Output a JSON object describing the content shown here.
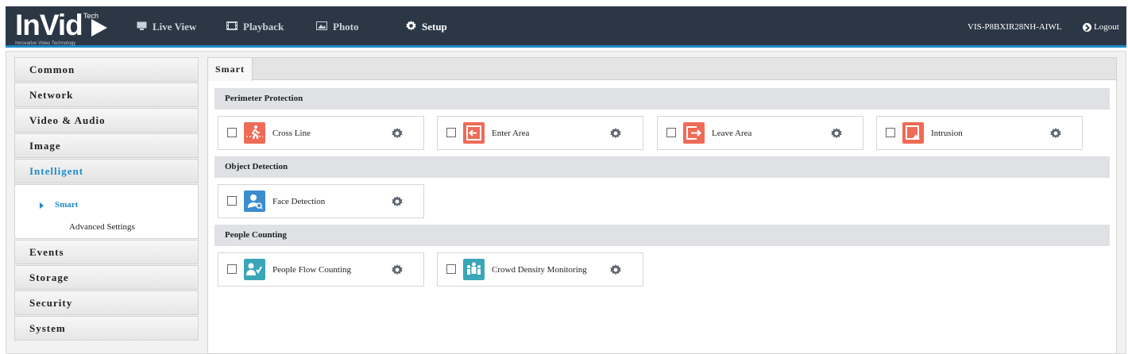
{
  "header": {
    "logo_text": "InVid",
    "logo_tech": "Tech",
    "logo_sub": "Innovative Video Technology",
    "nav": [
      {
        "label": "Live View",
        "icon": "monitor-icon"
      },
      {
        "label": "Playback",
        "icon": "film-icon"
      },
      {
        "label": "Photo",
        "icon": "photo-icon"
      },
      {
        "label": "Setup",
        "icon": "gear-icon",
        "active": true
      }
    ],
    "device_name": "VIS-P8BXIR28NH-AIWL",
    "logout_label": "Logout"
  },
  "sidebar": {
    "items": [
      {
        "label": "Common"
      },
      {
        "label": "Network"
      },
      {
        "label": "Video & Audio"
      },
      {
        "label": "Image"
      },
      {
        "label": "Intelligent",
        "active": true
      }
    ],
    "sub_items": [
      {
        "label": "Smart",
        "selected": true
      },
      {
        "label": "Advanced Settings"
      }
    ],
    "items_after": [
      {
        "label": "Events"
      },
      {
        "label": "Storage"
      },
      {
        "label": "Security"
      },
      {
        "label": "System"
      }
    ]
  },
  "main": {
    "tab": "Smart",
    "sections": [
      {
        "title": "Perimeter Protection",
        "functions": [
          {
            "label": "Cross Line",
            "icon": "cross-line-icon",
            "color": "#ee6b57",
            "checked": false
          },
          {
            "label": "Enter Area",
            "icon": "enter-area-icon",
            "color": "#ee6b57",
            "checked": false
          },
          {
            "label": "Leave Area",
            "icon": "leave-area-icon",
            "color": "#ee6b57",
            "checked": false
          },
          {
            "label": "Intrusion",
            "icon": "intrusion-icon",
            "color": "#ee6b57",
            "checked": false
          }
        ]
      },
      {
        "title": "Object Detection",
        "functions": [
          {
            "label": "Face Detection",
            "icon": "face-detection-icon",
            "color": "#3c8dcf",
            "checked": false
          }
        ]
      },
      {
        "title": "People Counting",
        "functions": [
          {
            "label": "People Flow Counting",
            "icon": "people-flow-icon",
            "color": "#3aa6b7",
            "checked": false
          },
          {
            "label": "Crowd Density Monitoring",
            "icon": "crowd-density-icon",
            "color": "#3aa6b7",
            "checked": false
          }
        ]
      }
    ]
  },
  "colors": {
    "header_bg": "#2c3746",
    "accent": "#1d8ac9",
    "perimeter_icon": "#ee6b57",
    "face_icon": "#3c8dcf",
    "people_icon": "#3aa6b7"
  }
}
